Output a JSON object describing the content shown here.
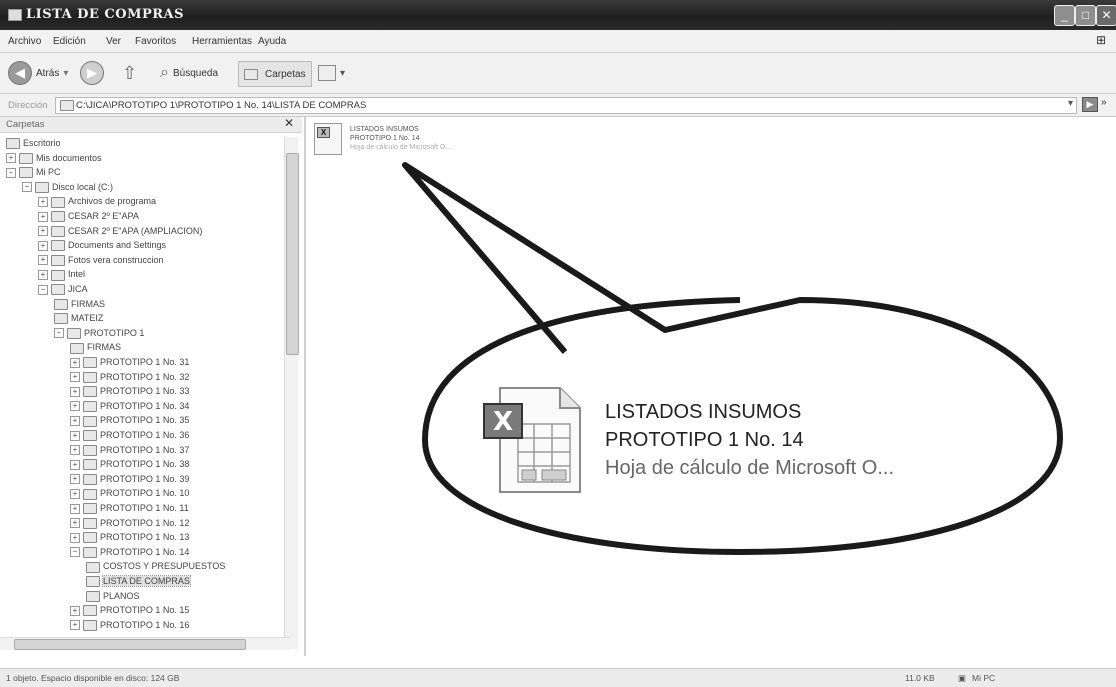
{
  "window": {
    "title": "LISTA DE COMPRAS",
    "buttons": {
      "minimize": "_",
      "maximize": "□",
      "close": "✕"
    }
  },
  "menu": [
    "Archivo",
    "Edición",
    "Ver",
    "Favoritos",
    "Herramientas",
    "Ayuda"
  ],
  "toolbar": {
    "back_label": "Atrás",
    "search_label": "Búsqueda",
    "folders_label": "Carpetas"
  },
  "address": {
    "label": "Dirección",
    "path": "C:\\JICA\\PROTOTIPO 1\\PROTOTIPO 1 No. 14\\LISTA DE COMPRAS"
  },
  "folder_pane": {
    "title": "Carpetas",
    "close": "✕",
    "tree": [
      {
        "label": "Escritorio",
        "expander": ""
      },
      {
        "label": "Mis documentos",
        "expander": "+"
      },
      {
        "label": "Mi PC",
        "expander": "−"
      },
      {
        "label": "Disco local (C:)",
        "expander": "−"
      },
      {
        "label": "Archivos de programa",
        "expander": "+"
      },
      {
        "label": "CESAR 2º E\"APA",
        "expander": "+"
      },
      {
        "label": "CESAR 2º E\"APA (AMPLIACION)",
        "expander": "+"
      },
      {
        "label": "Documents and Settings",
        "expander": "+"
      },
      {
        "label": "Fotos vera construccion",
        "expander": "+"
      },
      {
        "label": "Intel",
        "expander": "+"
      },
      {
        "label": "JICA",
        "expander": "−"
      },
      {
        "label": "FIRMAS",
        "expander": ""
      },
      {
        "label": "MATEIZ",
        "expander": ""
      },
      {
        "label": "PROTOTIPO 1",
        "expander": "−"
      },
      {
        "label": "FIRMAS",
        "expander": ""
      },
      {
        "label": "PROTOTIPO 1 No. 31",
        "expander": "+"
      },
      {
        "label": "PROTOTIPO 1 No. 32",
        "expander": "+"
      },
      {
        "label": "PROTOTIPO 1 No. 33",
        "expander": "+"
      },
      {
        "label": "PROTOTIPO 1 No. 34",
        "expander": "+"
      },
      {
        "label": "PROTOTIPO 1 No. 35",
        "expander": "+"
      },
      {
        "label": "PROTOTIPO 1 No. 36",
        "expander": "+"
      },
      {
        "label": "PROTOTIPO 1 No. 37",
        "expander": "+"
      },
      {
        "label": "PROTOTIPO 1 No. 38",
        "expander": "+"
      },
      {
        "label": "PROTOTIPO 1 No. 39",
        "expander": "+"
      },
      {
        "label": "PROTOTIPO 1 No. 10",
        "expander": "+"
      },
      {
        "label": "PROTOTIPO 1 No. 11",
        "expander": "+"
      },
      {
        "label": "PROTOTIPO 1 No. 12",
        "expander": "+"
      },
      {
        "label": "PROTOTIPO 1 No. 13",
        "expander": "+"
      },
      {
        "label": "PROTOTIPO 1 No. 14",
        "expander": "−"
      },
      {
        "label": "COSTOS Y PRESUPUESTOS",
        "expander": ""
      },
      {
        "label": "LISTA DE COMPRAS",
        "expander": ""
      },
      {
        "label": "PLANOS",
        "expander": ""
      },
      {
        "label": "PROTOTIPO 1 No. 15",
        "expander": "+"
      },
      {
        "label": "PROTOTIPO 1 No. 16",
        "expander": "+"
      }
    ]
  },
  "file": {
    "name_line1": "LISTADOS INSUMOS",
    "name_line2": "PROTOTIPO 1 No. 14",
    "type": "Hoja de cálculo de Microsoft O..."
  },
  "callout": {
    "line1": "LISTADOS INSUMOS",
    "line2": "PROTOTIPO 1 No. 14",
    "line3": "Hoja de cálculo de Microsoft O..."
  },
  "status": {
    "left": "1 objeto. Espacio disponible en disco: 124 GB",
    "size": "11.0 KB",
    "location": "Mi PC"
  }
}
